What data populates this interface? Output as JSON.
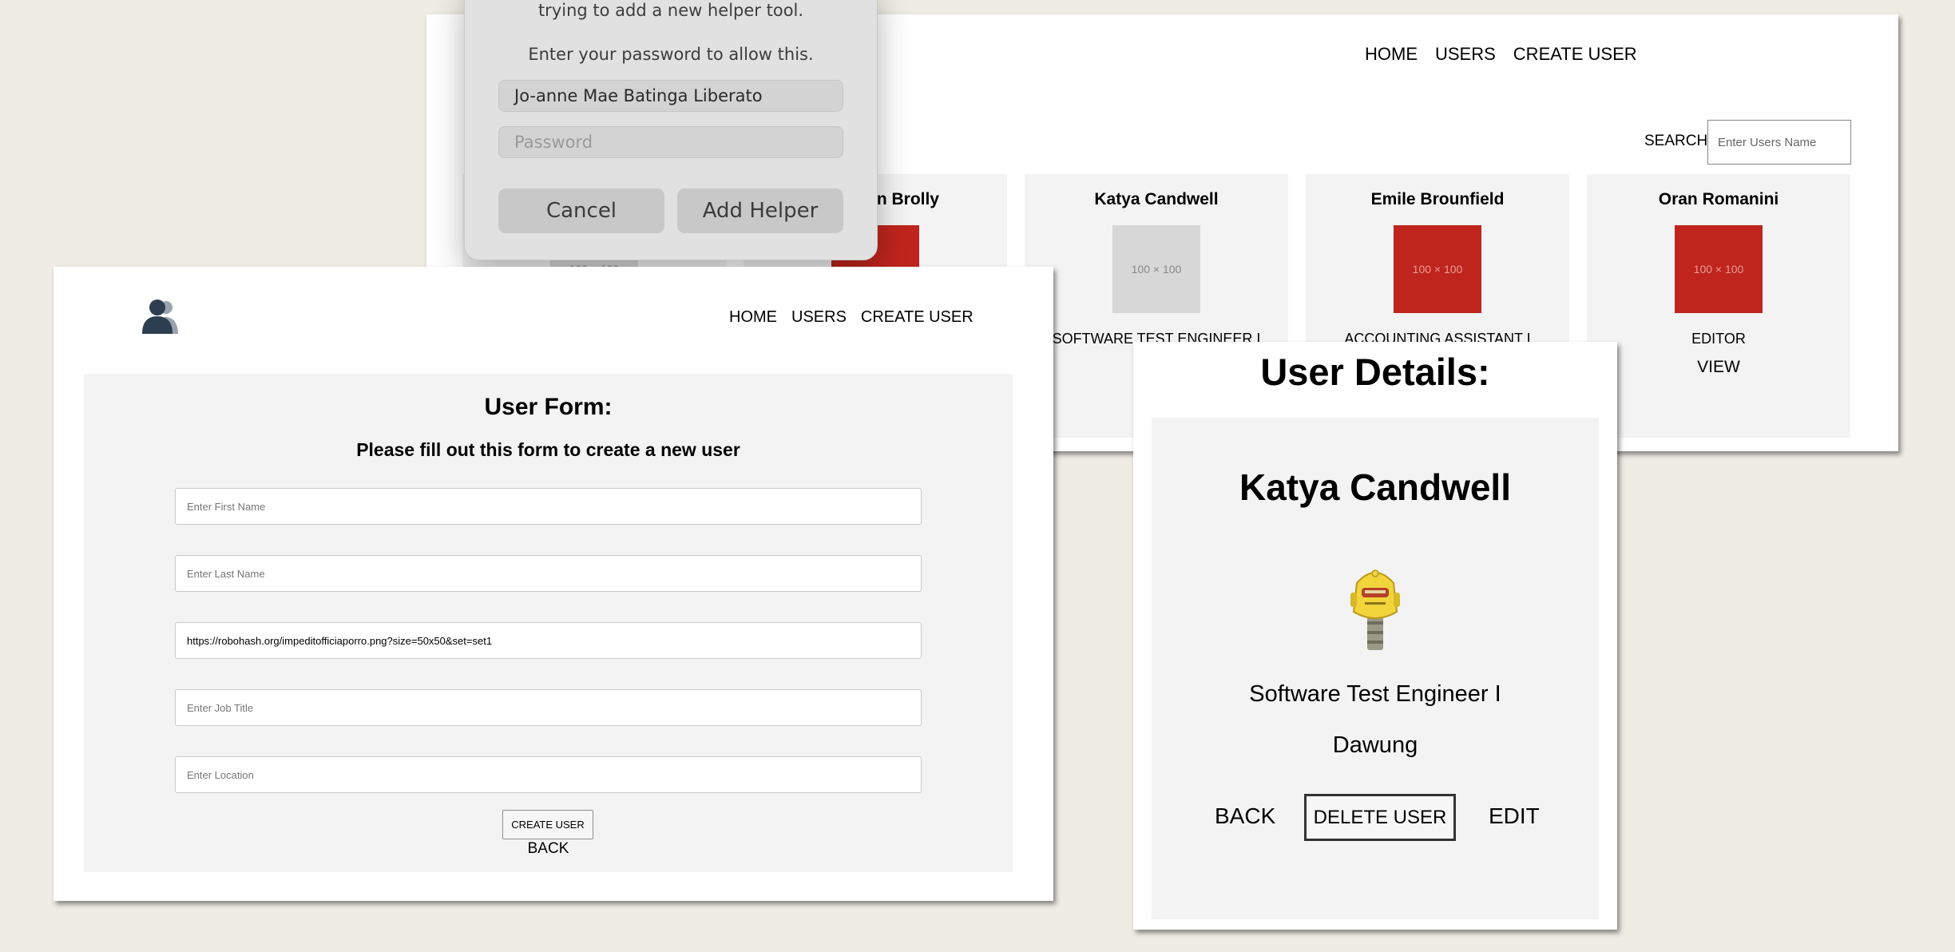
{
  "list_window": {
    "nav": [
      "HOME",
      "USERS",
      "CREATE USER"
    ],
    "search_label": "SEARCH",
    "search_placeholder": "Enter Users Name",
    "cards": [
      {
        "name": "",
        "thumb": "100 × 100",
        "thumb_color": "gray",
        "title": "",
        "view": ""
      },
      {
        "name": "n Brolly",
        "thumb": "",
        "thumb_color": "red",
        "title": "",
        "view": ""
      },
      {
        "name": "Katya Candwell",
        "thumb": "100 × 100",
        "thumb_color": "gray",
        "title": "SOFTWARE TEST ENGINEER I",
        "view": ""
      },
      {
        "name": "Emile Brounfield",
        "thumb": "100 × 100",
        "thumb_color": "red",
        "title": "ACCOUNTING ASSISTANT I",
        "view": ""
      },
      {
        "name": "Oran Romanini",
        "thumb": "100 × 100",
        "thumb_color": "red",
        "title": "EDITOR",
        "view": "VIEW"
      }
    ]
  },
  "dialog": {
    "line1": "trying to add a new helper tool.",
    "line2": "Enter your password to allow this.",
    "username": "Jo-anne Mae Batinga Liberato",
    "password_placeholder": "Password",
    "cancel": "Cancel",
    "add_helper": "Add Helper"
  },
  "form_window": {
    "nav": [
      "HOME",
      "USERS",
      "CREATE USER"
    ],
    "title": "User Form:",
    "subtitle": "Please fill out this form to create a new user",
    "fields": {
      "first_name_placeholder": "Enter First Name",
      "last_name_placeholder": "Enter Last Name",
      "avatar_value": "https://robohash.org/impeditofficiaporro.png?size=50x50&set=set1",
      "job_title_placeholder": "Enter Job Title",
      "location_placeholder": "Enter Location"
    },
    "submit": "CREATE USER",
    "back": "BACK"
  },
  "detail_window": {
    "heading": "User Details:",
    "name": "Katya Candwell",
    "job": "Software Test Engineer I",
    "location": "Dawung",
    "back": "BACK",
    "delete": "DELETE USER",
    "edit": "EDIT"
  },
  "colors": {
    "background": "#efece4",
    "panel": "#f3f3f3",
    "thumb_red": "#bf251d",
    "thumb_gray": "#d7d7d7"
  }
}
